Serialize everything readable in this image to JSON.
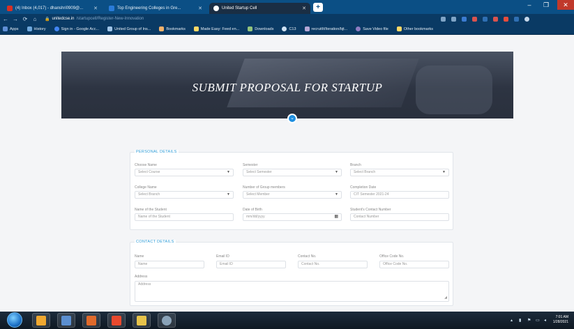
{
  "browser": {
    "tabs": [
      {
        "label": "(4) Inbox (4,017) - dhanshri0909@...",
        "favicon_color": "#d93025",
        "active": false
      },
      {
        "label": "Top Engineering Colleges in Gre...",
        "favicon_color": "#2a7bd8",
        "active": false
      },
      {
        "label": "United Startup Cell",
        "favicon_color": "#ffffff",
        "active": true
      }
    ],
    "new_tab": "+",
    "window_controls": [
      "–",
      "❐",
      "✕"
    ],
    "nav": {
      "back": "←",
      "forward": "→",
      "reload": "⟳",
      "home": "⌂"
    },
    "address": {
      "host": "unitedcse.in",
      "path": "/startupcell/Register-New-Innovation"
    },
    "bookmarks": [
      {
        "label": "Apps",
        "color": "#5f8fd6"
      },
      {
        "label": "History",
        "color": "#6fa8dc"
      },
      {
        "label": "Sign in - Google Acc...",
        "color": "#4285f4"
      },
      {
        "label": "United Group of Ins...",
        "color": "#9fc5e8"
      },
      {
        "label": "Bookmarks",
        "color": "#f6b26b"
      },
      {
        "label": "Made Easy: Feed en...",
        "color": "#ffd966"
      },
      {
        "label": "Downloads",
        "color": "#93c47d"
      },
      {
        "label": "C13",
        "color": "#cfe2f3"
      },
      {
        "label": "recruitIt/Iteration/bjt...",
        "color": "#b4a7d6"
      },
      {
        "label": "Save Video file",
        "color": "#8e7cc3"
      },
      {
        "label": "Other bookmarks",
        "color": "#ffd966"
      }
    ]
  },
  "hero": {
    "title": "SUBMIT PROPOSAL FOR STARTUP",
    "badge_icon": "chevron-down-icon"
  },
  "personal_details": {
    "title": "PERSONAL DETAILS",
    "fields": [
      {
        "label": "Choose Name",
        "value": "Select Course",
        "type": "select"
      },
      {
        "label": "Semester",
        "value": "Select Semester",
        "type": "select"
      },
      {
        "label": "Branch",
        "value": "Select Branch",
        "type": "select"
      },
      {
        "label": "College Name",
        "value": "Select Branch",
        "type": "select"
      },
      {
        "label": "Number of Group members",
        "value": "Select Member",
        "type": "select"
      },
      {
        "label": "Completion Date",
        "value": "CIT Semester 2021-24",
        "type": "text"
      },
      {
        "label": "Name of the Student",
        "value": "Name of the Student",
        "type": "text"
      },
      {
        "label": "Date of Birth",
        "value": "mm/dd/yyyy",
        "type": "date"
      },
      {
        "label": "Student's Contact Number",
        "value": "Contact Number",
        "type": "text"
      }
    ]
  },
  "contact_details": {
    "title": "CONTACT DETAILS",
    "fields": [
      {
        "label": "Name",
        "value": "Name"
      },
      {
        "label": "Email ID",
        "value": "Email ID"
      },
      {
        "label": "Contact No.",
        "value": "Contact No."
      },
      {
        "label": "Office Code No.",
        "value": "Office Code No."
      }
    ],
    "address": {
      "label": "Address",
      "value": "Address"
    }
  },
  "taskbar": {
    "apps": [
      "ie-icon",
      "folder-icon",
      "media-icon",
      "brave-icon",
      "explorer-icon",
      "tools-icon"
    ],
    "clock_time": "7:01 AM",
    "clock_date": "1/28/2021"
  }
}
